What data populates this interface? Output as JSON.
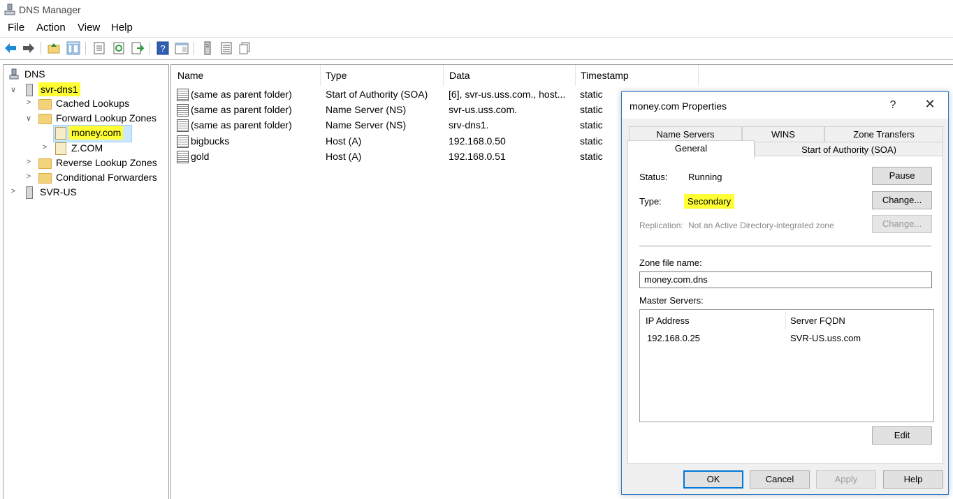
{
  "app": {
    "title": "DNS Manager"
  },
  "menu": [
    "File",
    "Action",
    "View",
    "Help"
  ],
  "tree": {
    "root": "DNS",
    "server1": "svr-dns1",
    "cached_lookups": "Cached Lookups",
    "forward_lookup_zones": "Forward Lookup Zones",
    "zone_money": "money.com",
    "zone_z": "Z.COM",
    "reverse_lookup_zones": "Reverse Lookup Zones",
    "conditional_forwarders": "Conditional Forwarders",
    "server2": "SVR-US"
  },
  "records": {
    "columns": [
      "Name",
      "Type",
      "Data",
      "Timestamp"
    ],
    "rows": [
      {
        "name": "(same as parent folder)",
        "type": "Start of Authority (SOA)",
        "data": "[6], svr-us.uss.com., host...",
        "timestamp": "static"
      },
      {
        "name": "(same as parent folder)",
        "type": "Name Server (NS)",
        "data": "svr-us.uss.com.",
        "timestamp": "static"
      },
      {
        "name": "(same as parent folder)",
        "type": "Name Server (NS)",
        "data": "srv-dns1.",
        "timestamp": "static"
      },
      {
        "name": "bigbucks",
        "type": "Host (A)",
        "data": "192.168.0.50",
        "timestamp": "static"
      },
      {
        "name": "gold",
        "type": "Host (A)",
        "data": "192.168.0.51",
        "timestamp": "static"
      }
    ]
  },
  "dialog": {
    "title": "money.com Properties",
    "help_glyph": "?",
    "close_glyph": "✕",
    "tabs_back": [
      "Name Servers",
      "WINS",
      "Zone Transfers"
    ],
    "tabs_front": [
      "General",
      "Start of Authority (SOA)"
    ],
    "active_tab": "General",
    "status_label": "Status:",
    "status_value": "Running",
    "pause_button": "Pause",
    "type_label": "Type:",
    "type_value": "Secondary",
    "change_button": "Change...",
    "replication_label": "Replication:",
    "replication_value": "Not an Active Directory-integrated zone",
    "replication_change_button": "Change...",
    "zone_file_label": "Zone file name:",
    "zone_file_value": "money.com.dns",
    "master_servers_label": "Master Servers:",
    "master_columns": [
      "IP Address",
      "Server FQDN"
    ],
    "master_rows": [
      {
        "ip": "192.168.0.25",
        "fqdn": "SVR-US.uss.com"
      }
    ],
    "edit_button": "Edit",
    "ok_button": "OK",
    "cancel_button": "Cancel",
    "apply_button": "Apply",
    "help_button": "Help"
  },
  "colors": {
    "highlight": "#ffff33",
    "dialog_border": "#2e7bc6",
    "back_arrow": "#1e8ad6"
  }
}
